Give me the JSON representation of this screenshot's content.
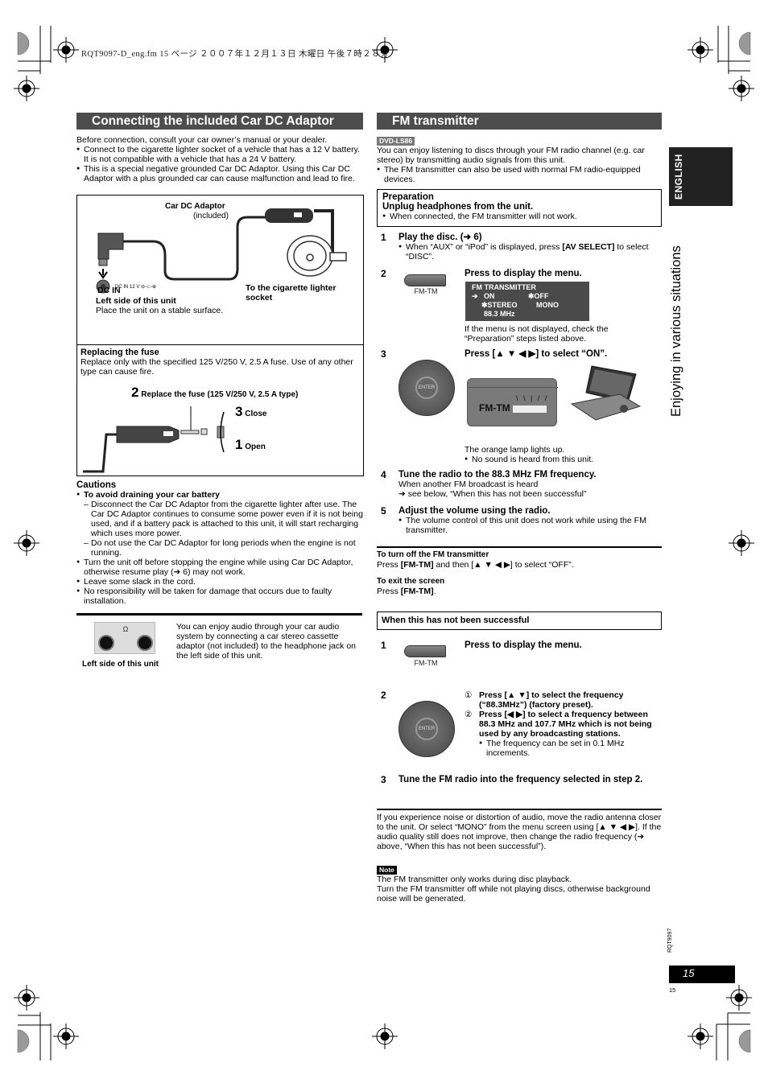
{
  "print_header": "RQT9097-D_eng.fm  15 ページ  ２００７年１２月１３日  木曜日  午後７時２８分",
  "left": {
    "title": "Connecting the included Car DC Adaptor",
    "intro": "Before connection, consult your car owner’s manual or your dealer.",
    "bullets": [
      "Connect to the cigarette lighter socket of a vehicle that has a 12 V battery. It is not compatible with a vehicle that has a 24 V battery.",
      "This is a special negative grounded Car DC Adaptor. Using this Car DC Adaptor with a plus grounded car can cause malfunction and lead to fire."
    ],
    "diagram": {
      "adaptor_label": "Car DC Adaptor",
      "adaptor_sub": "(included)",
      "dc_jack_label": "DC IN 12 V",
      "dc_in": "DC IN",
      "left_side": "Left side of this unit",
      "stable": "Place the unit on a stable surface.",
      "socket": "To the cigarette lighter socket"
    },
    "fuse": {
      "title": "Replacing the fuse",
      "text": "Replace only with the specified 125 V/250 V, 2.5 A fuse. Use of any other type can cause fire.",
      "step2_num": "2",
      "step2": "Replace the fuse (125 V/250 V, 2.5 A type)",
      "step3_num": "3",
      "step3": "Close",
      "step1_num": "1",
      "step1": "Open"
    },
    "cautions": {
      "title": "Cautions",
      "battery_head": "To avoid draining your car battery",
      "dashes": [
        "Disconnect the Car DC Adaptor from the cigarette lighter after use. The Car DC Adaptor continues to consume some power even if it is not being used, and if a battery pack is attached to this unit, it will start recharging which uses more power.",
        "Do not use the Car DC Adaptor for long periods when the engine is not running."
      ],
      "bullets": [
        "Turn the unit off before stopping the engine while using Car DC Adaptor, otherwise resume play (➜ 6) may not work.",
        "Leave some slack in the cord.",
        "No responsibility will be taken for damage that occurs due to faulty installation."
      ]
    },
    "audio": {
      "caption": "Left side of this unit",
      "headphone_symbol": "Ω",
      "text": "You can enjoy audio through your car audio system by connecting a car stereo cassette adaptor (not included) to the headphone jack on the left side of this unit."
    }
  },
  "right": {
    "title": "FM transmitter",
    "model_tag": "DVD-LS86",
    "intro": "You can enjoy listening to discs through your FM radio channel (e.g. car stereo) by transmitting audio signals from this unit.",
    "bullets": [
      "The FM transmitter can also be used with normal FM radio-equipped devices."
    ],
    "prep": {
      "title": "Preparation",
      "sub": "Unplug headphones from the unit.",
      "bullet": "When connected, the FM transmitter will not work."
    },
    "steps": [
      {
        "num": "1",
        "title": "Play the disc. (➜ 6)",
        "bullet_pre": "When “AUX” or “iPod” is displayed, press ",
        "bullet_bold": "[AV SELECT]",
        "bullet_post": " to select “DISC”."
      },
      {
        "num": "2",
        "title": "Press to display the menu.",
        "button_label": "FM-TM",
        "note": "If the menu is not displayed, check the “Preparation” steps listed above."
      },
      {
        "num": "3",
        "title": "Press [▲ ▼ ◀ ▶] to select “ON”.",
        "dpad_center": "ENTER",
        "panel_label": "FM-TM",
        "note": "The orange lamp lights up.",
        "bullet": "No sound is heard from this unit."
      },
      {
        "num": "4",
        "title": "Tune the radio to the 88.3 MHz FM frequency.",
        "line1": "When another FM broadcast is heard",
        "line2": "➜ see below, “When this has not been successful”"
      },
      {
        "num": "5",
        "title": "Adjust the volume using the radio.",
        "bullet": "The volume control of this unit does not work while using the FM transmitter."
      }
    ],
    "menu_screen": {
      "line1": "FM  TRANSMITTER",
      "arrow": "➔",
      "on": "ON",
      "off": "✱OFF",
      "stereo": "✱STEREO",
      "mono": "MONO",
      "freq": "88.3 MHz"
    },
    "turn_off": {
      "title": "To turn off the FM transmitter",
      "pre": "Press ",
      "bold": "[FM-TM]",
      "post": " and then [▲ ▼ ◀ ▶] to select “OFF”."
    },
    "exit": {
      "title": "To exit the screen",
      "pre": "Press ",
      "bold": "[FM-TM]",
      "post": "."
    },
    "not_success": {
      "title": "When this has not been successful",
      "steps": [
        {
          "num": "1",
          "title": "Press to display the menu.",
          "button_label": "FM-TM"
        },
        {
          "num": "2",
          "dpad_center": "ENTER",
          "items": [
            {
              "marker": "①",
              "text": "Press [▲ ▼] to select the frequency (“88.3MHz”) (factory preset)."
            },
            {
              "marker": "②",
              "text": "Press [◀ ▶] to select a frequency between 88.3 MHz and 107.7 MHz which is not being used by any broadcasting stations."
            }
          ],
          "bullet": "The frequency can be set in 0.1 MHz increments."
        },
        {
          "num": "3",
          "title": "Tune the FM radio into the frequency selected in step 2."
        }
      ]
    },
    "noise": "If you experience noise or distortion of audio, move the radio antenna closer to the unit. Or select “MONO” from the menu screen using [▲ ▼ ◀ ▶]. If the audio quality still does not improve, then change the radio frequency (➜ above, “When this has not been successful”).",
    "note_tag": "Note",
    "note_lines": [
      "The FM transmitter only works during disc playback.",
      "Turn the FM transmitter off while not playing discs, otherwise background noise will be generated."
    ]
  },
  "side": {
    "language": "ENGLISH",
    "section": "Enjoying in various situations",
    "doc_code": "RQT9097",
    "page_number": "15",
    "small_page": "15"
  }
}
